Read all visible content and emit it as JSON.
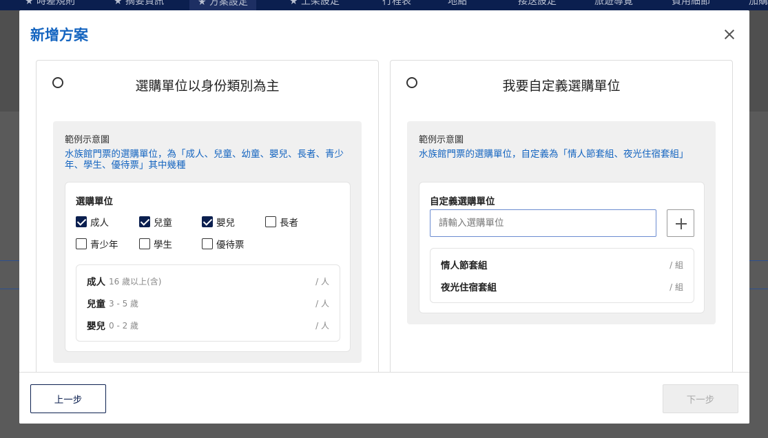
{
  "background": {
    "nav_items": [
      "★ 時差規則",
      "★ 摘要資訊",
      "★ 方案設定",
      "★ 上架設定",
      "行程表",
      "地點",
      "接送設定",
      "旅遊導覽",
      "費用細節",
      "加購"
    ]
  },
  "modal": {
    "title": "新增方案",
    "close_icon": "close-icon"
  },
  "option_identity": {
    "title": "選購單位以身份類別為主",
    "example_label": "範例示意圖",
    "example_desc": "水族館門票的選購單位，為「成人、兒童、幼童、嬰兒、長者、青少年、學生、優待票」其中幾種",
    "units_title": "選購單位",
    "checkboxes": [
      {
        "label": "成人",
        "checked": true
      },
      {
        "label": "兒童",
        "checked": true
      },
      {
        "label": "嬰兒",
        "checked": true
      },
      {
        "label": "長者",
        "checked": false
      },
      {
        "label": "青少年",
        "checked": false
      },
      {
        "label": "學生",
        "checked": false
      },
      {
        "label": "優待票",
        "checked": false
      }
    ],
    "rows": [
      {
        "name": "成人",
        "age": "16 歲以上(含)",
        "unit": "/ 人"
      },
      {
        "name": "兒童",
        "age": "3 - 5 歲",
        "unit": "/ 人"
      },
      {
        "name": "嬰兒",
        "age": "0 - 2 歲",
        "unit": "/ 人"
      }
    ]
  },
  "option_custom": {
    "title": "我要自定義選購單位",
    "example_label": "範例示意圖",
    "example_desc": "水族館門票的選購單位，自定義為「情人節套組、夜光住宿套組」",
    "units_title": "自定義選購單位",
    "input_placeholder": "請輸入選購單位",
    "input_value": "",
    "add_icon": "plus-icon",
    "rows": [
      {
        "name": "情人節套組",
        "unit": "/ 組"
      },
      {
        "name": "夜光住宿套組",
        "unit": "/ 組"
      }
    ]
  },
  "footer": {
    "prev_label": "上一步",
    "next_label": "下一步"
  },
  "colors": {
    "accent": "#1565c0",
    "navy": "#0b1f4f"
  }
}
